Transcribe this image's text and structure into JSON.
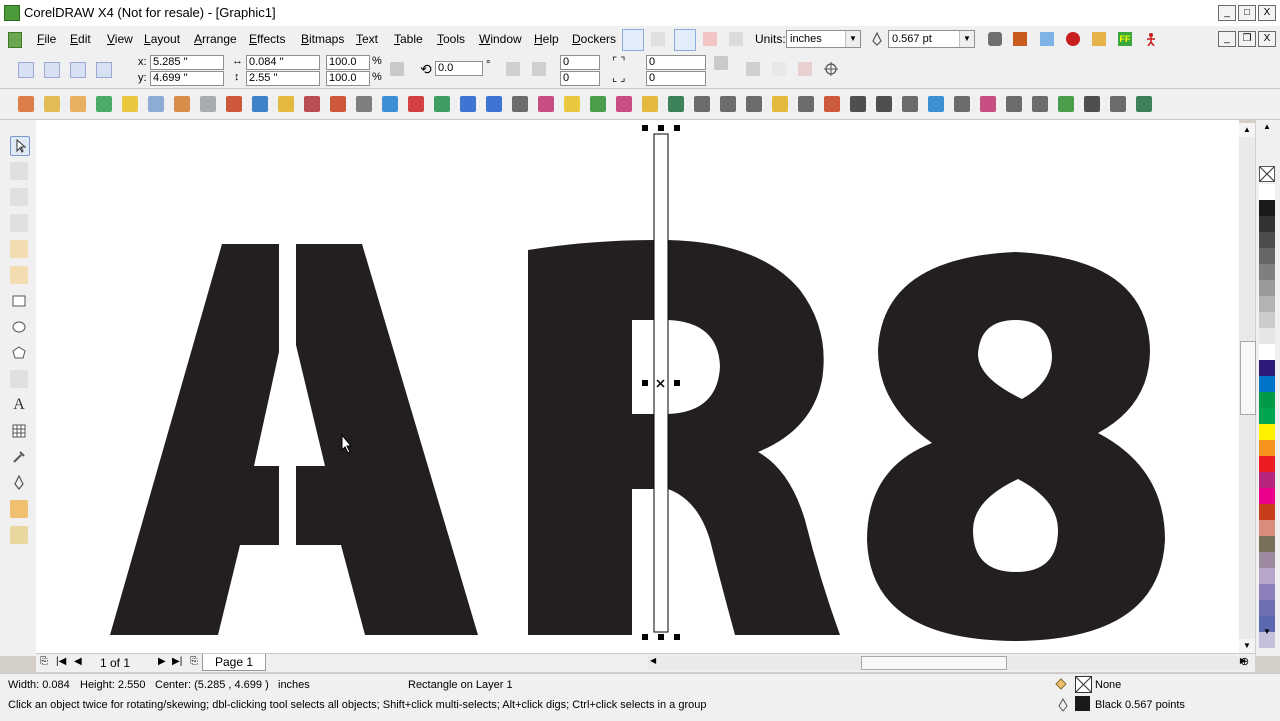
{
  "window": {
    "title": "CorelDRAW X4 (Not for resale) - [Graphic1]",
    "controls": [
      "_",
      "□",
      "X"
    ]
  },
  "menu": [
    {
      "label": "File",
      "u": "F",
      "rest": "ile"
    },
    {
      "label": "Edit",
      "u": "E",
      "rest": "dit"
    },
    {
      "label": "View",
      "u": "V",
      "rest": "iew"
    },
    {
      "label": "Layout",
      "u": "L",
      "rest": "ayout"
    },
    {
      "label": "Arrange",
      "u": "A",
      "rest": "rrange"
    },
    {
      "label": "Effects",
      "u": "E",
      "rest": "ffects"
    },
    {
      "label": "Bitmaps",
      "u": "B",
      "rest": "itmaps"
    },
    {
      "label": "Text",
      "u": "T",
      "rest": "ext"
    },
    {
      "label": "Table",
      "u": "T",
      "rest": "able"
    },
    {
      "label": "Tools",
      "u": "T",
      "rest": "ools"
    },
    {
      "label": "Window",
      "u": "W",
      "rest": "indow"
    },
    {
      "label": "Help",
      "u": "H",
      "rest": "elp"
    },
    {
      "label": "Dockers",
      "u": "D",
      "rest": "ockers"
    }
  ],
  "units": {
    "label": "Units:",
    "value": "inches"
  },
  "outline_width": "0.567 pt",
  "properties": {
    "x_label": "x:",
    "x": "5.285 \"",
    "y_label": "y:",
    "y": "4.699 \"",
    "width": "0.084 \"",
    "height": "2.55 \"",
    "scale_w": "100.0",
    "scale_h": "100.0",
    "percent": "%",
    "rotation": "0.0",
    "degree": "°",
    "corner_a": "0",
    "corner_b": "0",
    "corner_c": "0",
    "corner_d": "0"
  },
  "artwork": {
    "letters": "AR8"
  },
  "page_nav": {
    "counter": "1 of 1",
    "tab": "Page 1"
  },
  "status": {
    "width": "Width: 0.084",
    "height": "Height: 2.550",
    "center": "Center: (5.285 , 4.699 )",
    "units": "inches",
    "object": "Rectangle on Layer 1",
    "hint": "Click an object twice for rotating/skewing; dbl-clicking tool selects all objects; Shift+click multi-selects; Alt+click digs; Ctrl+click selects in a group",
    "fill": "None",
    "outline_color": "Black",
    "outline_width": "0.567 points"
  },
  "colors": {
    "artwork": "#231f20",
    "selection": "#000000",
    "palette": [
      "#ffffff",
      "#1a1a1a",
      "#333333",
      "#4d4d4d",
      "#666666",
      "#7f7f7f",
      "#999999",
      "#b3b3b3",
      "#cccccc",
      "#e6e6e6",
      "#ffffff",
      "#2e1a7a",
      "#0074c8",
      "#009a49",
      "#00a651",
      "#fff200",
      "#f7941d",
      "#ed1c24",
      "#b5267c",
      "#ec008c",
      "#c83e1a",
      "#d98c7a",
      "#7a6f5a",
      "#9d8aa0",
      "#b7a6c9",
      "#8c7eb8",
      "#6d6fb3",
      "#5b68b0",
      "#c4c0dc"
    ]
  }
}
